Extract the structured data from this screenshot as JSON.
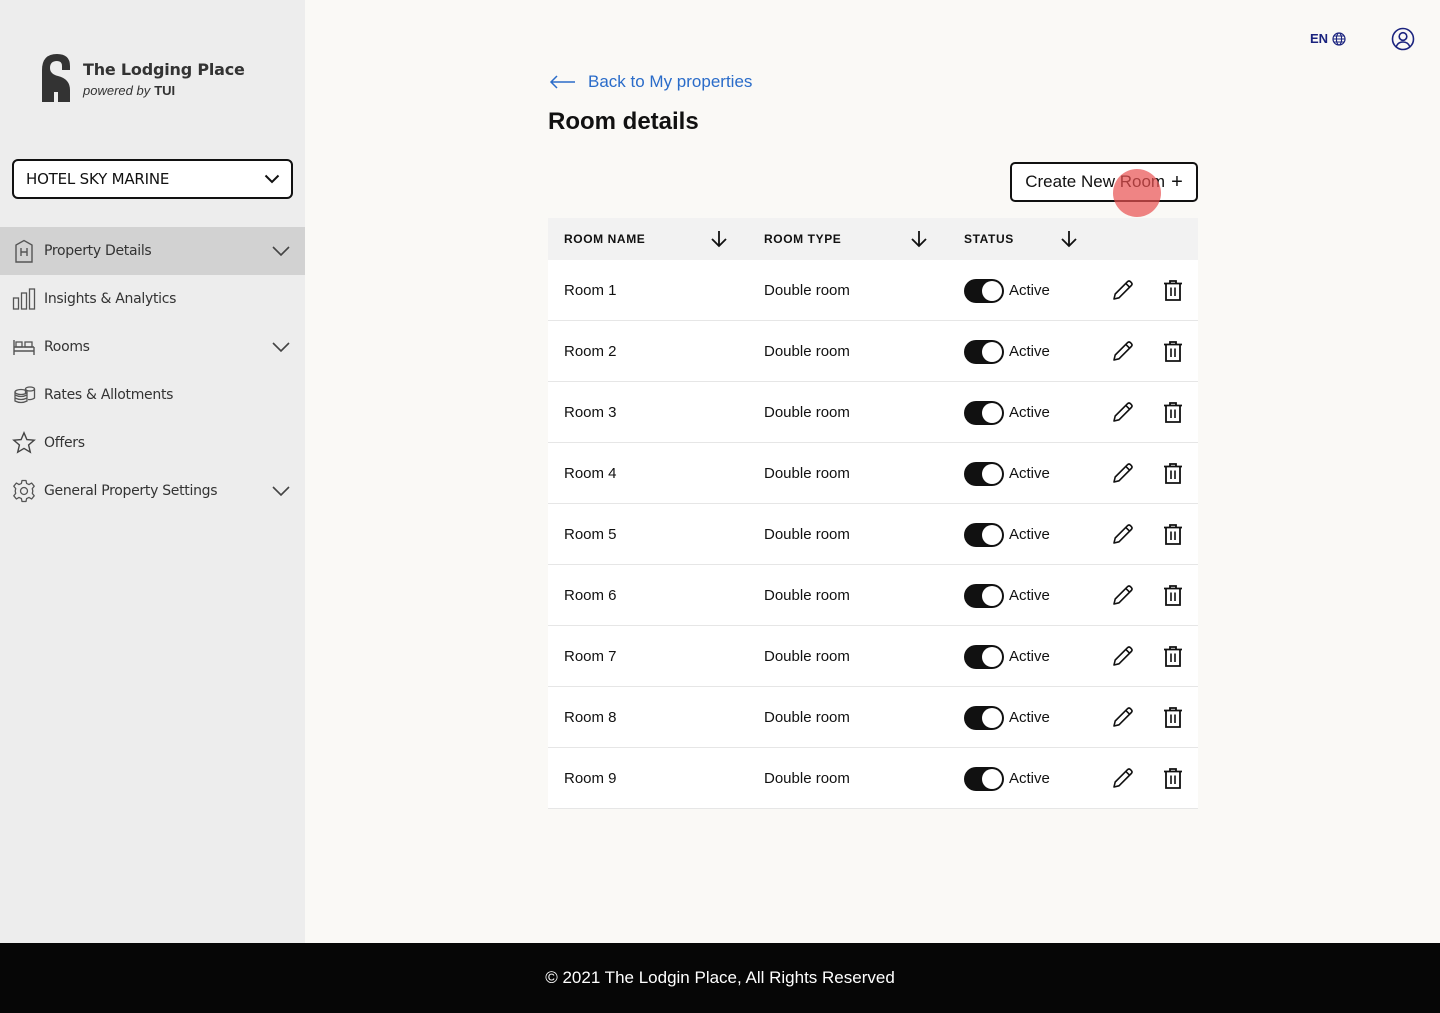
{
  "brand": {
    "title": "The Lodging Place",
    "powered_by": "powered by",
    "partner": "TUI"
  },
  "hotel_selector": {
    "value": "HOTEL SKY MARINE"
  },
  "nav": {
    "items": [
      {
        "label": "Property Details",
        "icon": "building-icon",
        "active": true,
        "expandable": true
      },
      {
        "label": "Insights & Analytics",
        "icon": "bar-chart-icon",
        "active": false,
        "expandable": false
      },
      {
        "label": "Rooms",
        "icon": "bed-icon",
        "active": false,
        "expandable": true
      },
      {
        "label": "Rates & Allotments",
        "icon": "coins-icon",
        "active": false,
        "expandable": false
      },
      {
        "label": "Offers",
        "icon": "star-icon",
        "active": false,
        "expandable": false
      },
      {
        "label": "General Property Settings",
        "icon": "gear-icon",
        "active": false,
        "expandable": true
      }
    ]
  },
  "header": {
    "language": "EN"
  },
  "main": {
    "back_link": "Back to My properties",
    "title": "Room details",
    "create_button": "Create New Room",
    "create_button_icon": "+"
  },
  "table": {
    "columns": [
      "ROOM NAME",
      "ROOM TYPE",
      "STATUS"
    ],
    "rows": [
      {
        "name": "Room 1",
        "type": "Double room",
        "status": "Active",
        "enabled": true
      },
      {
        "name": "Room 2",
        "type": "Double room",
        "status": "Active",
        "enabled": true
      },
      {
        "name": "Room 3",
        "type": "Double room",
        "status": "Active",
        "enabled": true
      },
      {
        "name": "Room 4",
        "type": "Double room",
        "status": "Active",
        "enabled": true
      },
      {
        "name": "Room 5",
        "type": "Double room",
        "status": "Active",
        "enabled": true
      },
      {
        "name": "Room 6",
        "type": "Double room",
        "status": "Active",
        "enabled": true
      },
      {
        "name": "Room 7",
        "type": "Double room",
        "status": "Active",
        "enabled": true
      },
      {
        "name": "Room 8",
        "type": "Double room",
        "status": "Active",
        "enabled": true
      },
      {
        "name": "Room 9",
        "type": "Double room",
        "status": "Active",
        "enabled": true
      }
    ]
  },
  "footer": {
    "text": "© 2021 The Lodgin Place, All Rights Reserved"
  },
  "colors": {
    "link": "#2a6cc9",
    "sidebar": "#ededed",
    "active_nav": "#d2d2d2",
    "footer": "#060606",
    "lang": "#1a237e"
  }
}
